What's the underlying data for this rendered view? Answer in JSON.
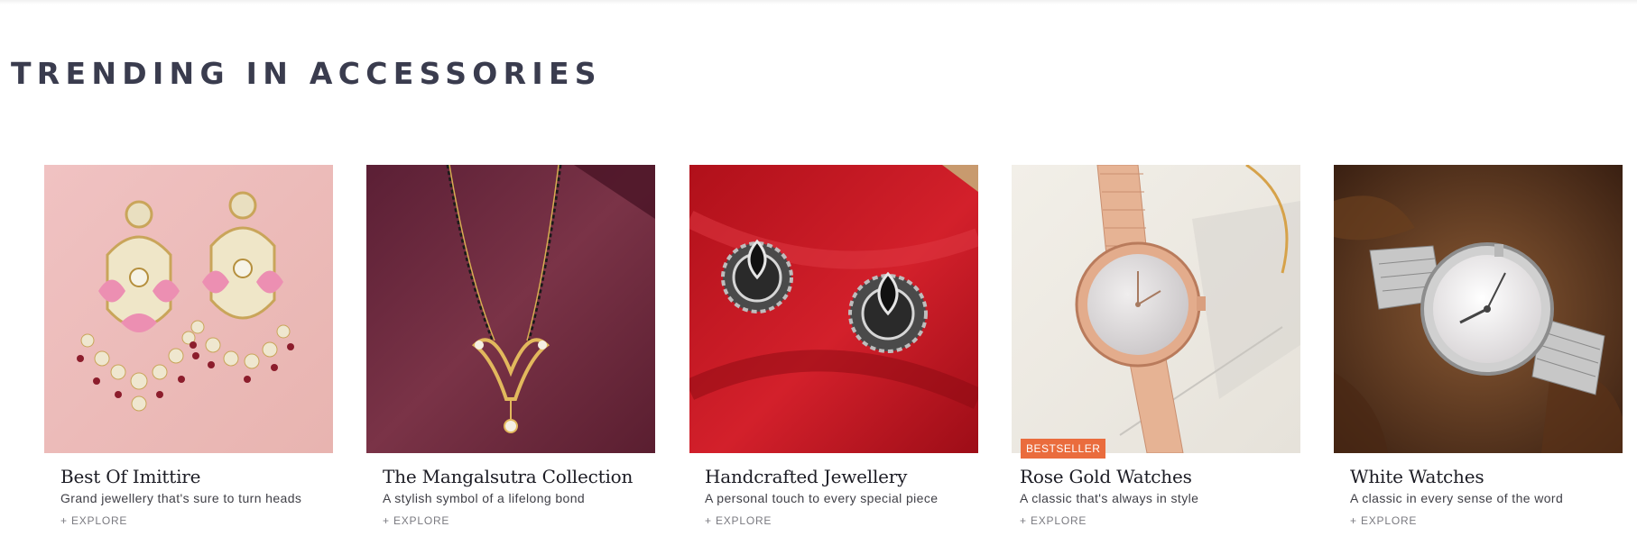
{
  "section": {
    "title": "TRENDING IN ACCESSORIES"
  },
  "cards": [
    {
      "title": "Best Of Imittire",
      "subtitle": "Grand jewellery that's sure to turn heads",
      "link": "+ EXPLORE",
      "image_icon": "earrings-image"
    },
    {
      "title": "The Mangalsutra Collection",
      "subtitle": "A stylish symbol of a lifelong bond",
      "link": "+ EXPLORE",
      "image_icon": "mangalsutra-image"
    },
    {
      "title": "Handcrafted Jewellery",
      "subtitle": "A personal touch to every special piece",
      "link": "+ EXPLORE",
      "image_icon": "oxidised-studs-image"
    },
    {
      "title": "Rose Gold Watches",
      "subtitle": "A classic that's always in style",
      "link": "+ EXPLORE",
      "badge": "BESTSELLER",
      "image_icon": "rose-gold-watch-image"
    },
    {
      "title": "White Watches",
      "subtitle": "A classic in every sense of the word",
      "link": "+ EXPLORE",
      "image_icon": "white-watch-image"
    }
  ],
  "colors": {
    "title_text": "#3a3c4e",
    "badge_bg": "#ea6c3d",
    "link_text": "#7a7a80"
  }
}
